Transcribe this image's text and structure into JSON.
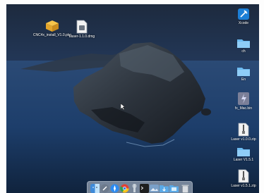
{
  "desktop": {
    "icons_left": [
      {
        "name": "cnc-install-package",
        "label": "CNC4x_install_V1.0.pkg",
        "icon": "package-icon"
      },
      {
        "name": "laser-dmg",
        "label": "Laser-1.1.0.dmg",
        "icon": "disk-image-icon"
      }
    ],
    "icons_right": [
      {
        "name": "xcode",
        "label": "Xcode",
        "icon": "xcode-icon"
      },
      {
        "name": "folder-ch",
        "label": "ch",
        "icon": "folder-icon"
      },
      {
        "name": "folder-en",
        "label": "En",
        "icon": "folder-icon"
      },
      {
        "name": "fx-mac-bin",
        "label": "fx_Mac.bin",
        "icon": "binary-file-icon"
      },
      {
        "name": "laser-zip-1",
        "label": "Laser v1.0.0.zip",
        "icon": "zip-file-icon"
      },
      {
        "name": "laser-folder",
        "label": "Laser V1.5.1",
        "icon": "folder-icon"
      },
      {
        "name": "laser-zip-2",
        "label": "Laser v1.5.1.zip",
        "icon": "zip-file-icon"
      }
    ]
  },
  "dock": {
    "items": [
      {
        "name": "finder",
        "icon": "finder-icon",
        "color": "#3e8ad8"
      },
      {
        "name": "launchpad",
        "icon": "launchpad-icon",
        "color": "#6d7a8c"
      },
      {
        "name": "safari",
        "icon": "safari-icon",
        "color": "#2d8bf0"
      },
      {
        "name": "chrome",
        "icon": "chrome-icon",
        "color": "#e0e0e0"
      },
      {
        "name": "utility",
        "icon": "utility-icon",
        "color": "#c9d2da"
      },
      {
        "name": "terminal",
        "icon": "terminal-icon",
        "color": "#1e1e1e"
      },
      {
        "name": "preview",
        "icon": "preview-icon",
        "color": "#7aa0c8"
      },
      {
        "name": "downloads",
        "icon": "downloads-folder-icon",
        "color": "#5aa9e6"
      },
      {
        "name": "documents",
        "icon": "documents-folder-icon",
        "color": "#5aa9e6"
      },
      {
        "name": "trash",
        "icon": "trash-icon",
        "color": "#d9dde2"
      }
    ]
  }
}
